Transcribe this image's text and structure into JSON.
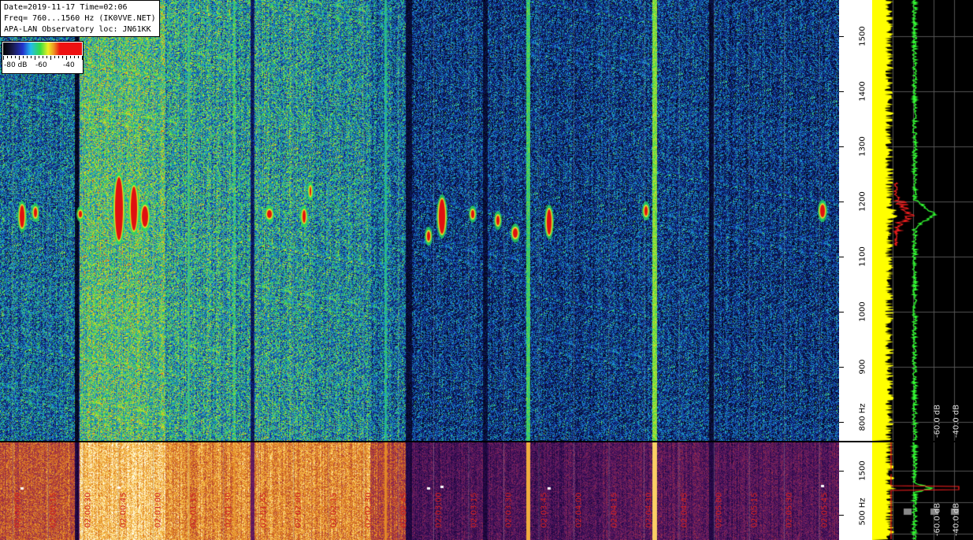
{
  "info": {
    "line1": "Date=2019-11-17 Time=02:06",
    "line2": "Freq= 760...1560 Hz (IK0VVE.NET)",
    "line3": "APA-LAN Observatory loc: JN61KK"
  },
  "legend": {
    "label_80": "-80 dB",
    "label_60": "-60",
    "label_40": "-40"
  },
  "freq_axis_top": {
    "labels": [
      "1500",
      "1400",
      "1300",
      "1200",
      "1100",
      "1000",
      "900",
      "800 Hz"
    ]
  },
  "freq_axis_bottom": {
    "labels": [
      "1500",
      "500 Hz"
    ]
  },
  "spectrum_top": {
    "db_labels": [
      "-60.0 dB",
      "-40.0 dB"
    ]
  },
  "spectrum_bottom": {
    "db_labels": [
      "-60.0 dB",
      "-40.0 dB"
    ]
  },
  "time_labels": [
    "02:00:00",
    "02:00:15",
    "02:00:30",
    "02:00:45",
    "02:01:00",
    "02:01:15",
    "02:01:30",
    "02:01:45",
    "02:02:00",
    "02:02:15",
    "02:02:30",
    "02:02:45",
    "02:03:00",
    "02:03:15",
    "02:03:30",
    "02:03:45",
    "02:04:00",
    "02:04:15",
    "02:04:30",
    "02:04:45",
    "02:05:00",
    "02:05:15",
    "02:05:30",
    "02:05:45"
  ],
  "colors": {
    "spectrum_avg": "#ffff00",
    "spectrum_peak": "#33ff33",
    "spectrum_signal": "#ff2020",
    "time_label": "#d02020"
  }
}
